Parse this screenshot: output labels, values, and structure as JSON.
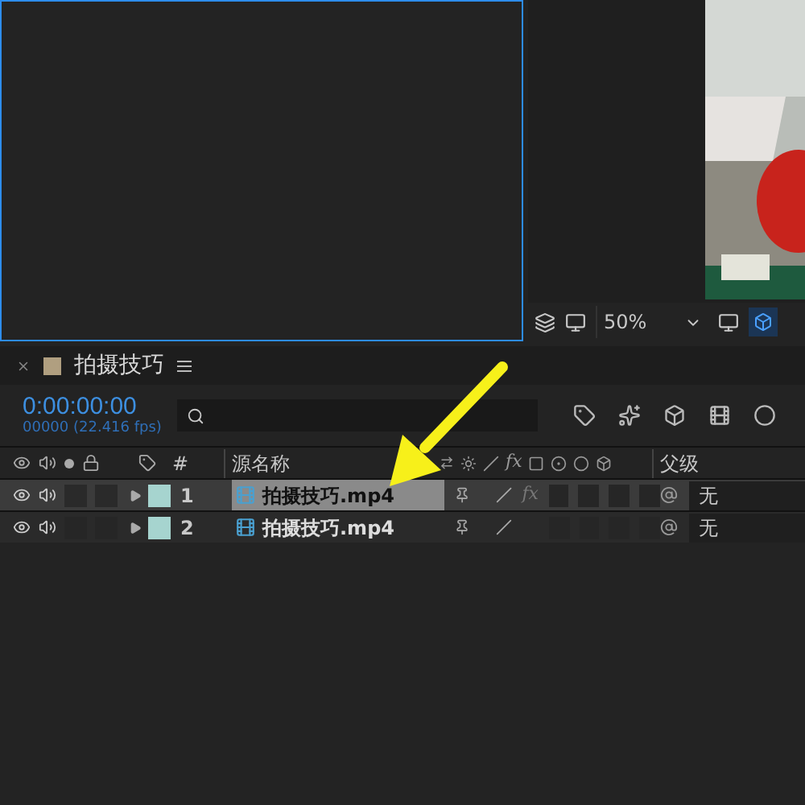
{
  "viewer": {
    "zoom": "50%"
  },
  "timeline": {
    "tab_title": "拍摄技巧",
    "timecode": "0:00:00:00",
    "fps": "00000 (22.416 fps)",
    "columns": {
      "number": "#",
      "source_name": "源名称",
      "effects": "fx",
      "parent": "父级"
    },
    "layers": [
      {
        "number": "1",
        "name": "拍摄技巧.mp4",
        "parent": "无",
        "selected": true,
        "effects": "fx"
      },
      {
        "number": "2",
        "name": "拍摄技巧.mp4",
        "parent": "无",
        "selected": false
      }
    ]
  }
}
